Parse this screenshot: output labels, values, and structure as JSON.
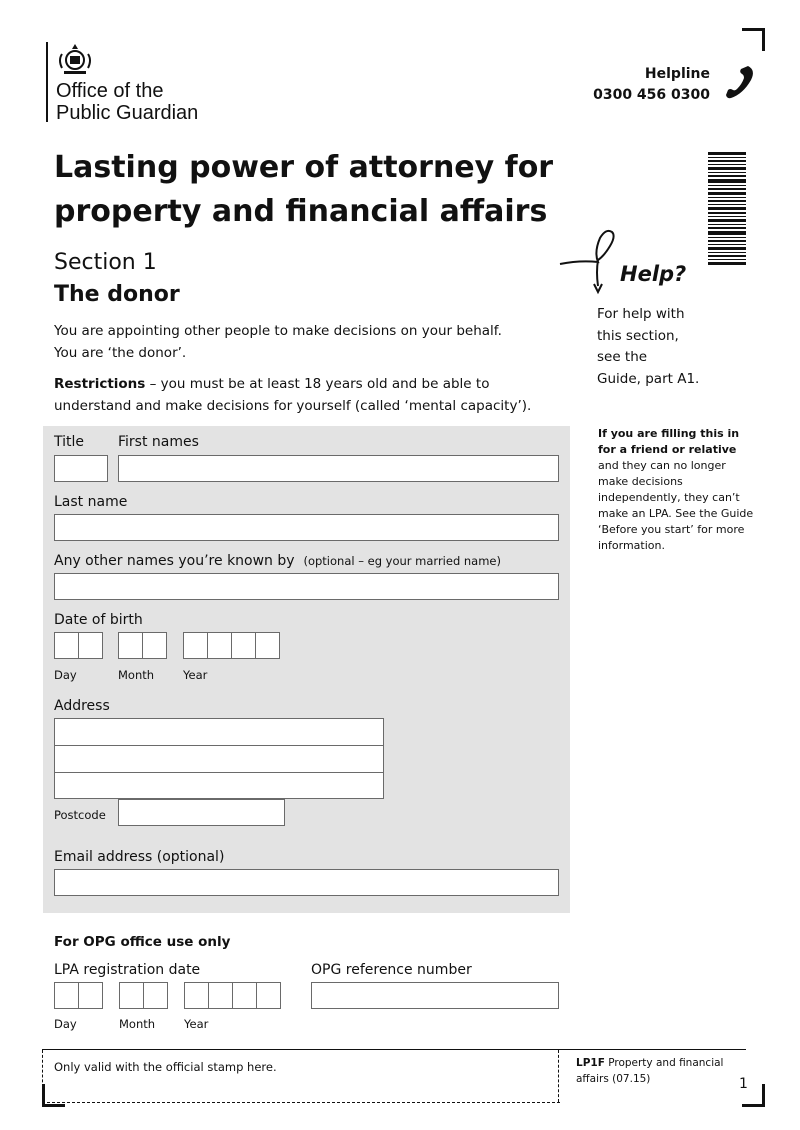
{
  "header": {
    "org_line1": "Office of the",
    "org_line2": "Public Guardian",
    "helpline_label": "Helpline",
    "helpline_number": "0300 456 0300"
  },
  "title_line1": "Lasting power of attorney for",
  "title_line2": "property and financial affairs",
  "section": {
    "number": "Section 1",
    "name": "The donor"
  },
  "intro": {
    "line1": "You are appointing other people to make decisions on your behalf.",
    "line2": "You are ‘the donor’."
  },
  "restrictions": {
    "label": "Restrictions",
    "text": " – you must be at least 18 years old and be able to understand and make decisions for yourself (called ‘mental capacity’)."
  },
  "help": {
    "title": "Help?",
    "line1": "For help with",
    "line2": "this section,",
    "line3": "see the",
    "line4": "Guide, part A1."
  },
  "side_note": {
    "bold": "If you are filling this in for a friend or relative",
    "text": " and they can no longer make decisions independently, they can’t make an LPA. See the Guide ‘Before you start’ for more information."
  },
  "form": {
    "title_label": "Title",
    "first_names_label": "First names",
    "last_name_label": "Last name",
    "other_names_label": "Any other names you’re known by",
    "other_names_hint": "(optional – eg your married name)",
    "dob_label": "Date of birth",
    "day_label": "Day",
    "month_label": "Month",
    "year_label": "Year",
    "address_label": "Address",
    "postcode_label": "Postcode",
    "email_label": "Email address (optional)"
  },
  "opg": {
    "heading": "For OPG office use only",
    "reg_date_label": "LPA registration date",
    "ref_label": "OPG reference number",
    "day_label": "Day",
    "month_label": "Month",
    "year_label": "Year"
  },
  "footer": {
    "stamp_text": "Only valid with the official stamp here.",
    "form_code": "LP1F",
    "form_desc": " Property and financial affairs (07.15)",
    "page_number": "1"
  }
}
